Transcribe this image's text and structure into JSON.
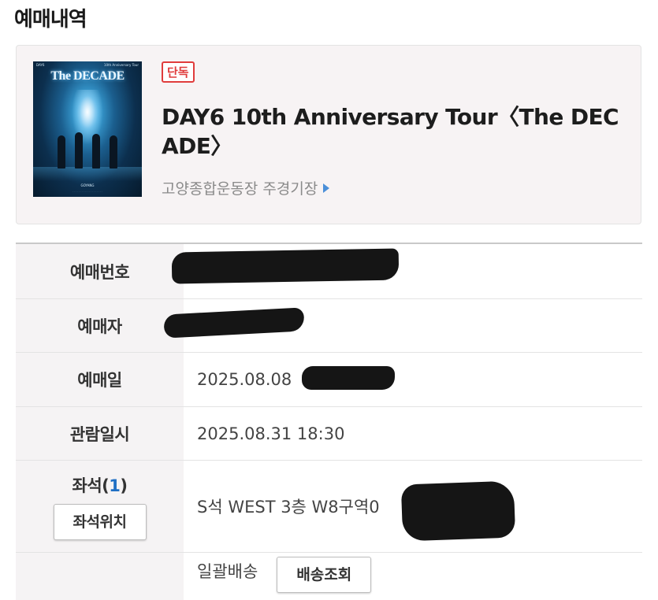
{
  "page": {
    "title": "예매내역"
  },
  "event": {
    "badge": "단독",
    "title": "DAY6 10th Anniversary Tour〈The DECADE〉",
    "venue": "고양종합운동장 주경기장",
    "poster": {
      "brand": "DAY6",
      "subtitle": "10th Anniversary Tour",
      "title": "The DECADE",
      "venue": "GOYANG"
    }
  },
  "details": {
    "booking_number": {
      "label": "예매번호",
      "value": ""
    },
    "booker": {
      "label": "예매자",
      "value": ""
    },
    "booking_date": {
      "label": "예매일",
      "value": "2025.08.08"
    },
    "show_datetime": {
      "label": "관람일시",
      "value": "2025.08.31 18:30"
    },
    "seat": {
      "label": "좌석",
      "count_open": "(",
      "count": "1",
      "count_close": ")",
      "location_button": "좌석위치",
      "value": "S석 WEST 3층 W8구역0"
    },
    "delivery": {
      "method": "일괄배송",
      "track_button": "배송조회"
    }
  },
  "colors": {
    "badge_red": "#e03c3c",
    "accent_blue": "#1f6fc4",
    "arrow_blue": "#4b8fd8",
    "label_bg": "#f5f3f4"
  }
}
